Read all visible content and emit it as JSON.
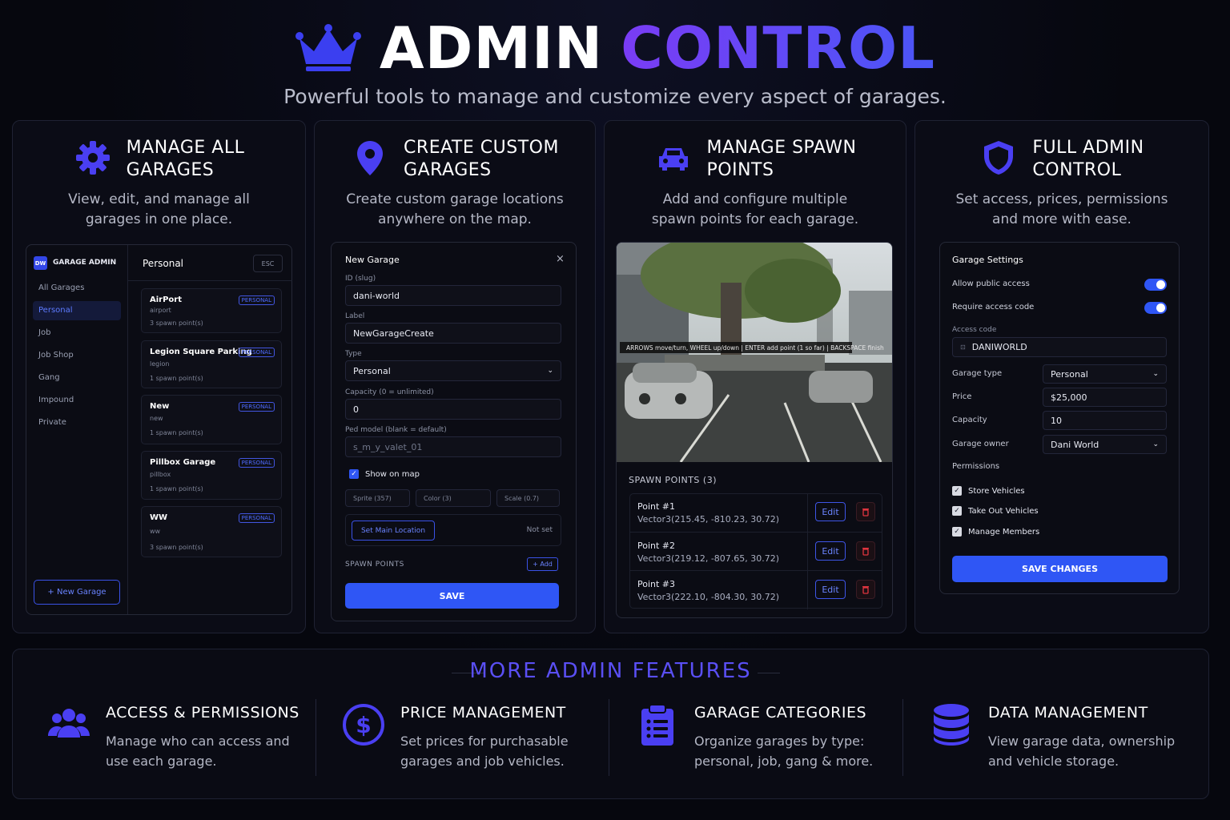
{
  "header": {
    "title_white": "ADMIN",
    "title_accent": "CONTROL",
    "subtitle": "Powerful tools to manage and customize every aspect of garages."
  },
  "cards": [
    {
      "title": "MANAGE ALL\nGARAGES",
      "desc": "View, edit, and manage all\ngarages in one place.",
      "icon": "gear-icon"
    },
    {
      "title": "CREATE CUSTOM\nGARAGES",
      "desc": "Create custom garage locations\nanywhere on the map.",
      "icon": "map-pin-icon"
    },
    {
      "title": "MANAGE SPAWN\nPOINTS",
      "desc": "Add and configure multiple\nspawn points for each garage.",
      "icon": "car-icon"
    },
    {
      "title": "FULL ADMIN\nCONTROL",
      "desc": "Set access, prices, permissions\nand more with ease.",
      "icon": "shield-icon"
    }
  ],
  "garage_admin": {
    "logo": "DW",
    "title": "GARAGE ADMIN",
    "section": "Personal",
    "esc": "ESC",
    "nav": [
      "All Garages",
      "Personal",
      "Job",
      "Job Shop",
      "Gang",
      "Impound",
      "Private"
    ],
    "garages": [
      {
        "name": "AirPort",
        "slug": "airport",
        "spawns": "3 spawn point(s)",
        "badge": "PERSONAL"
      },
      {
        "name": "Legion Square Parking",
        "slug": "legion",
        "spawns": "1 spawn point(s)",
        "badge": "PERSONAL"
      },
      {
        "name": "New",
        "slug": "new",
        "spawns": "1 spawn point(s)",
        "badge": "PERSONAL"
      },
      {
        "name": "Pillbox Garage",
        "slug": "pillbox",
        "spawns": "1 spawn point(s)",
        "badge": "PERSONAL"
      },
      {
        "name": "WW",
        "slug": "ww",
        "spawns": "3 spawn point(s)",
        "badge": "PERSONAL"
      }
    ],
    "new_button": "+ New Garage"
  },
  "new_garage": {
    "title": "New Garage",
    "close": "×",
    "id_label": "ID (slug)",
    "id_value": "dani-world",
    "label_label": "Label",
    "label_value": "NewGarageCreate",
    "type_label": "Type",
    "type_value": "Personal",
    "capacity_label": "Capacity (0 = unlimited)",
    "capacity_value": "0",
    "ped_label": "Ped model (blank = default)",
    "ped_placeholder": "s_m_y_valet_01",
    "show_on_map": "Show on map",
    "sprite": "Sprite (357)",
    "color": "Color (3)",
    "scale": "Scale (0.7)",
    "set_location": "Set Main Location",
    "not_set": "Not set",
    "spawn_points": "SPAWN POINTS",
    "add": "+ Add",
    "save": "SAVE"
  },
  "spawn": {
    "overlay": "ARROWS move/turn, WHEEL up/down | ENTER add point (1 so far) | BACKSPACE finish",
    "header": "SPAWN POINTS (3)",
    "points": [
      {
        "name": "Point #1",
        "vec": "Vector3(215.45, -810.23, 30.72)",
        "edit": "Edit"
      },
      {
        "name": "Point #2",
        "vec": "Vector3(219.12, -807.65, 30.72)",
        "edit": "Edit"
      },
      {
        "name": "Point #3",
        "vec": "Vector3(222.10, -804.30, 30.72)",
        "edit": "Edit"
      }
    ]
  },
  "settings": {
    "title": "Garage Settings",
    "public": "Allow public access",
    "require": "Require access code",
    "code_label": "Access code",
    "code_value": "DANIWORLD",
    "type_label": "Garage type",
    "type_value": "Personal",
    "price_label": "Price",
    "price_value": "$25,000",
    "cap_label": "Capacity",
    "cap_value": "10",
    "owner_label": "Garage owner",
    "owner_value": "Dani World",
    "perm_label": "Permissions",
    "perms": [
      "Store Vehicles",
      "Take Out Vehicles",
      "Manage Members"
    ],
    "save": "SAVE CHANGES"
  },
  "more": {
    "title": "MORE ADMIN FEATURES",
    "features": [
      {
        "title": "ACCESS & PERMISSIONS",
        "desc": "Manage who can access and\nuse each garage.",
        "icon": "users-icon"
      },
      {
        "title": "PRICE MANAGEMENT",
        "desc": "Set prices for purchasable\ngarages and job vehicles.",
        "icon": "dollar-icon"
      },
      {
        "title": "GARAGE CATEGORIES",
        "desc": "Organize garages by type:\npersonal, job, gang & more.",
        "icon": "clipboard-list-icon"
      },
      {
        "title": "DATA MANAGEMENT",
        "desc": "View garage data, ownership\nand vehicle storage.",
        "icon": "database-icon"
      }
    ]
  },
  "colors": {
    "accent": "#2f56f5",
    "purple": "#7a3cf5",
    "bg": "#06070e"
  }
}
